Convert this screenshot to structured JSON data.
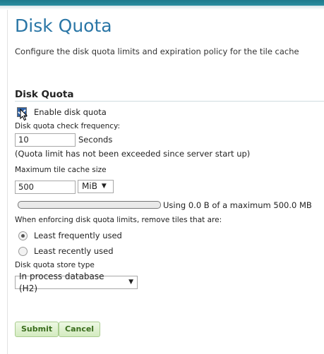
{
  "page": {
    "title": "Disk Quota",
    "description": "Configure the disk quota limits and expiration policy for the tile cache"
  },
  "section": {
    "heading": "Disk Quota"
  },
  "quota": {
    "enable_label": "Enable disk quota",
    "enabled": true,
    "check_frequency_label": "Disk quota check frequency:",
    "check_frequency_value": "10",
    "check_frequency_unit": "Seconds",
    "status_message": "(Quota limit has not been exceeded since server start up)",
    "max_size_label": "Maximum tile cache size",
    "max_size_value": "500",
    "max_size_unit": "MiB",
    "usage_text": "Using 0.0 B of a maximum 500.0 MB",
    "usage_fraction": 0.0,
    "policy_label": "When enforcing disk quota limits, remove tiles that are:",
    "policy_options": [
      {
        "label": "Least frequently used",
        "selected": true
      },
      {
        "label": "Least recently used",
        "selected": false
      }
    ],
    "store_type_label": "Disk quota store type",
    "store_type_value": "In process database (H2)"
  },
  "actions": {
    "submit_label": "Submit",
    "cancel_label": "Cancel"
  },
  "colors": {
    "title": "#2a76a6",
    "header_bar": "#1c7a8c",
    "button_text": "#3a6d1e"
  }
}
